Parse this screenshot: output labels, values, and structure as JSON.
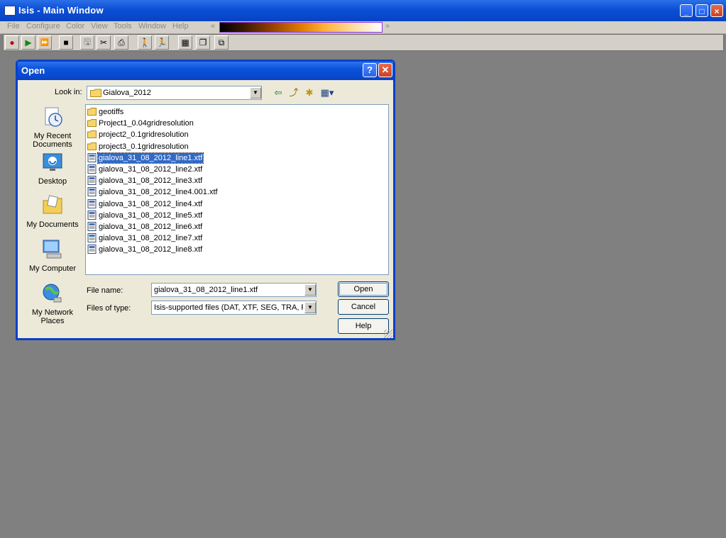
{
  "main_window": {
    "title": "Isis - Main Window",
    "controls": {
      "minimize": "_",
      "maximize": "□",
      "close": "×"
    },
    "menu": [
      "File",
      "Configure",
      "Color",
      "View",
      "Tools",
      "Window",
      "Help"
    ],
    "colorbar_left": "«",
    "colorbar_right": "»"
  },
  "toolbar": {
    "tools": [
      "record-icon",
      "play-icon",
      "fast-forward-icon",
      "stop-icon",
      "save-icon",
      "cut-icon",
      "print-icon",
      "walk-icon",
      "run-icon",
      "tile-icon",
      "cascade-icon",
      "window-icon"
    ],
    "glyphs": [
      "●",
      "▶",
      "⏩",
      "■",
      "🖫",
      "✂",
      "⎙",
      "🚶",
      "🏃",
      "▦",
      "❐",
      "⧉"
    ]
  },
  "dialog": {
    "title": "Open",
    "help_button": "?",
    "close_button": "✕",
    "lookin_label": "Look in:",
    "lookin_value": "Gialova_2012",
    "nav_glyphs": {
      "back": "⇦",
      "up": "⤴",
      "newfolder": "✱",
      "view": "▦▾"
    },
    "places": [
      {
        "name": "recent-documents",
        "label": "My Recent Documents"
      },
      {
        "name": "desktop",
        "label": "Desktop"
      },
      {
        "name": "my-documents",
        "label": "My Documents"
      },
      {
        "name": "my-computer",
        "label": "My Computer"
      },
      {
        "name": "my-network-places",
        "label": "My Network Places"
      }
    ],
    "files": [
      {
        "name": "geotiffs",
        "type": "folder"
      },
      {
        "name": "Project1_0.04gridresolution",
        "type": "folder"
      },
      {
        "name": "project2_0.1gridresolution",
        "type": "folder"
      },
      {
        "name": "project3_0.1gridresolution",
        "type": "folder"
      },
      {
        "name": "gialova_31_08_2012_line1.xtf",
        "type": "file",
        "selected": true
      },
      {
        "name": "gialova_31_08_2012_line2.xtf",
        "type": "file"
      },
      {
        "name": "gialova_31_08_2012_line3.xtf",
        "type": "file"
      },
      {
        "name": "gialova_31_08_2012_line4.001.xtf",
        "type": "file"
      },
      {
        "name": "gialova_31_08_2012_line4.xtf",
        "type": "file"
      },
      {
        "name": "gialova_31_08_2012_line5.xtf",
        "type": "file"
      },
      {
        "name": "gialova_31_08_2012_line6.xtf",
        "type": "file"
      },
      {
        "name": "gialova_31_08_2012_line7.xtf",
        "type": "file"
      },
      {
        "name": "gialova_31_08_2012_line8.xtf",
        "type": "file"
      }
    ],
    "filename_label": "File name:",
    "filename_value": "gialova_31_08_2012_line1.xtf",
    "filetype_label": "Files of type:",
    "filetype_value": "Isis-supported files (DAT, XTF, SEG, TRA, RUN",
    "open_label": "Open",
    "cancel_label": "Cancel",
    "help_label": "Help"
  }
}
